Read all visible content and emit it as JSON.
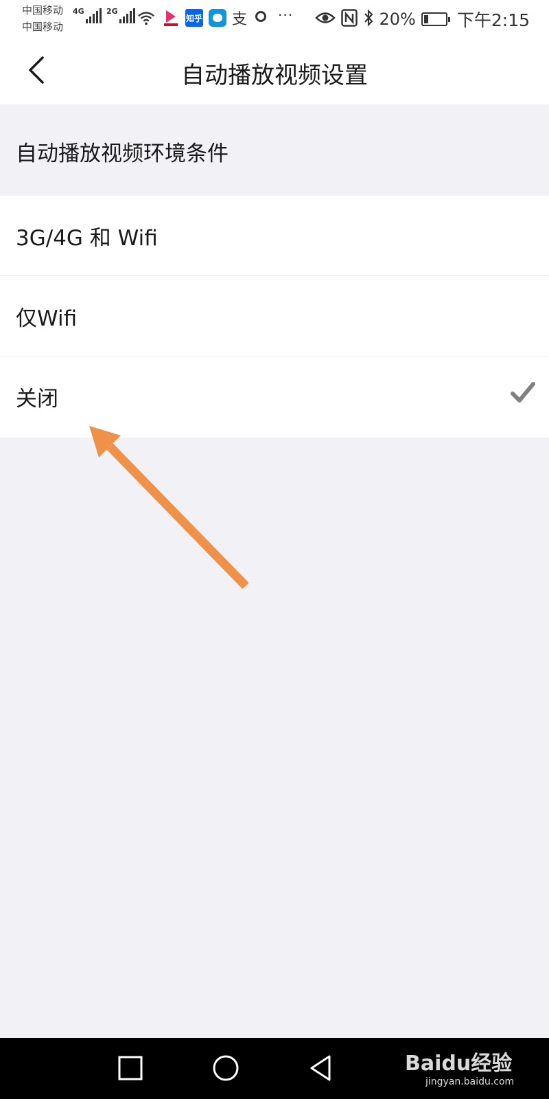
{
  "status_bar": {
    "carrier_1": "中国移动",
    "carrier_2": "中国移动",
    "net_type_1": "4G",
    "net_type_2": "2G",
    "battery_percent": "20%",
    "battery_level": 0.2,
    "time": "下午2:15",
    "zhihu_app_label": "知乎",
    "zhi_app_glyph": "支",
    "more_dots": "···",
    "icons": [
      "signal-icon",
      "wifi-icon",
      "app-notification-icon",
      "eye-comfort-icon",
      "nfc-icon",
      "bluetooth-icon",
      "battery-icon"
    ]
  },
  "header": {
    "title": "自动播放视频设置",
    "back_icon": "chevron-left-icon"
  },
  "section": {
    "title": "自动播放视频环境条件"
  },
  "options": [
    {
      "label": "3G/4G 和 Wifi",
      "selected": false
    },
    {
      "label": "仅Wifi",
      "selected": false
    },
    {
      "label": "关闭",
      "selected": true
    }
  ],
  "colors": {
    "accent_arrow": "#f0914a",
    "check": "#808080",
    "background": "#f2f2f6"
  },
  "navbar": {
    "icons": [
      "square-recents-icon",
      "circle-home-icon",
      "triangle-back-icon"
    ]
  },
  "watermark": {
    "main": "Baidu经验",
    "sub": "jingyan.baidu.com"
  }
}
